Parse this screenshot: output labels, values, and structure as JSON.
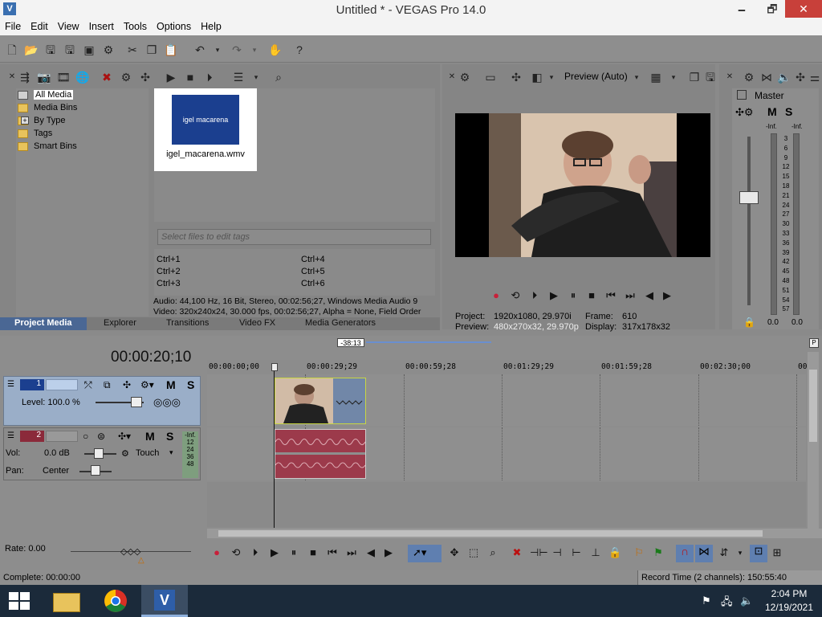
{
  "title": "Untitled * - VEGAS Pro 14.0",
  "window_buttons": {
    "minimize": "🗕",
    "restore": "🗗",
    "close": "✕"
  },
  "menu": [
    "File",
    "Edit",
    "View",
    "Insert",
    "Tools",
    "Options",
    "Help"
  ],
  "project_media": {
    "tree": [
      "All Media",
      "Media Bins",
      "By Type",
      "Tags",
      "Smart Bins"
    ],
    "expand": "+",
    "media_item": {
      "thumb_text": "igel macarena",
      "filename": "igel_macarena.wmv"
    },
    "tag_placeholder": "Select files to edit tags",
    "shortcuts": [
      "Ctrl+1",
      "Ctrl+2",
      "Ctrl+3",
      "Ctrl+4",
      "Ctrl+5",
      "Ctrl+6"
    ],
    "info_audio": "Audio: 44,100 Hz, 16 Bit, Stereo, 00:02:56;27, Windows Media Audio 9",
    "info_video": "Video: 320x240x24, 30.000 fps, 00:02:56;27, Alpha = None, Field Order"
  },
  "tabs": [
    "Project Media",
    "Explorer",
    "Transitions",
    "Video FX",
    "Media Generators"
  ],
  "video_preview": {
    "mode": "Preview (Auto)",
    "project_label": "Project:",
    "project_value": "1920x1080, 29.970i",
    "preview_label": "Preview:",
    "preview_value": "480x270x32, 29.970p",
    "frame_label": "Frame:",
    "frame_value": "610",
    "display_label": "Display:",
    "display_value": "317x178x32"
  },
  "master": {
    "label": "Master",
    "m": "M",
    "s": "S",
    "inf_left": "-Inf.",
    "inf_right": "-Inf.",
    "scale": [
      "3",
      "6",
      "9",
      "12",
      "15",
      "18",
      "21",
      "24",
      "27",
      "30",
      "33",
      "36",
      "39",
      "42",
      "45",
      "48",
      "51",
      "54",
      "57"
    ],
    "val_left": "0.0",
    "val_right": "0.0"
  },
  "timeline": {
    "timecode": "00:00:20;10",
    "loop_label": "-38:13",
    "ruler": [
      "00:00:00;00",
      "00:00:29;29",
      "00:00:59;28",
      "00:01:29;29",
      "00:01:59;28",
      "00:02:30;00",
      "00:0"
    ],
    "video_track": {
      "num": "1",
      "level_label": "Level: 100.0 %",
      "m": "M",
      "s": "S"
    },
    "audio_track": {
      "num": "2",
      "vol_label": "Vol:",
      "vol_value": "0.0 dB",
      "pan_label": "Pan:",
      "pan_value": "Center",
      "touch": "Touch",
      "m": "M",
      "s": "S",
      "meter": [
        "-Inf.",
        "12",
        "24",
        "36",
        "48"
      ]
    }
  },
  "rate": "Rate: 0.00",
  "status": {
    "complete": "Complete: 00:00:00",
    "record_time": "Record Time (2 channels): 150:55:40"
  },
  "taskbar": {
    "time": "2:04 PM",
    "date": "12/19/2021"
  },
  "colors": {
    "accent": "#1b3f8f",
    "audio": "#a33a4a",
    "track_selected": "#9aaec8",
    "record": "#c8203a"
  }
}
